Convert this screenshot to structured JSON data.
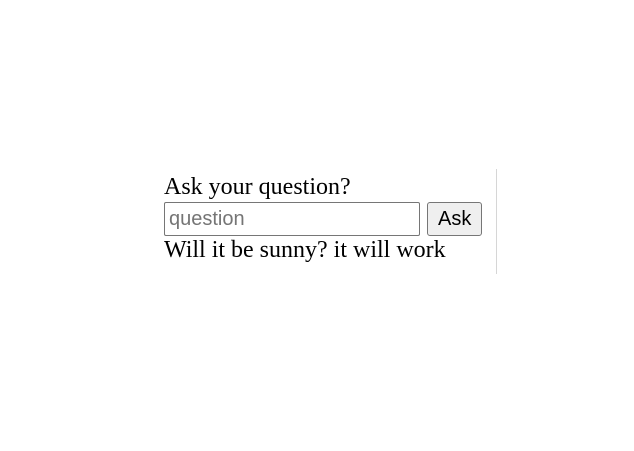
{
  "form": {
    "prompt": "Ask your question?",
    "input_placeholder": "question",
    "input_value": "",
    "ask_label": "Ask",
    "answer": "Will it be sunny? it will work"
  }
}
